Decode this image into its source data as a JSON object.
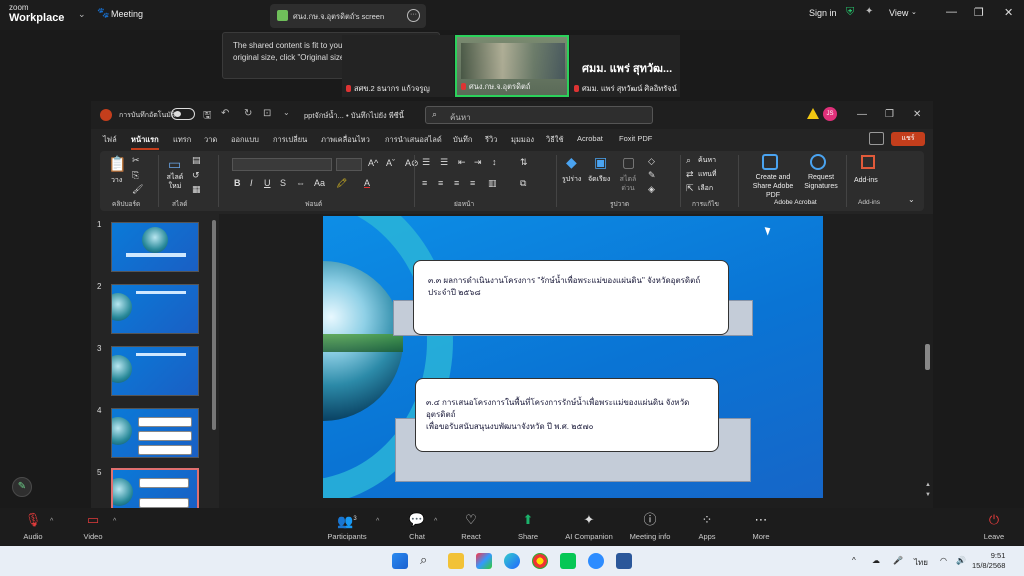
{
  "zoom": {
    "logo_line1": "zoom",
    "logo_line2": "Workplace",
    "meeting_label": "Meeting",
    "share_title": "ศนง.กษ.จ.อุตรดิตถ์'s screen",
    "sign_in": "Sign in",
    "view": "View",
    "tooltip": "The shared content is fit to your screen. To see the original size, click \"Original size\" in the menu.",
    "tiles": [
      {
        "name": "สศข.2 ธนากร แก้วจรูญ",
        "big": ""
      },
      {
        "name": "ศนง.กษ.จ.อุตรดิตถ์",
        "big": ""
      },
      {
        "name": "ศมม. แพร่ สุทวัฒน์ ศิลอิทรัจน์",
        "big": "ศมม. แพร่ สุทวัฒ..."
      }
    ],
    "bottom": {
      "audio": "Audio",
      "video": "Video",
      "participants": "Participants",
      "participants_count": "3",
      "chat": "Chat",
      "react": "React",
      "share": "Share",
      "ai_companion": "AI Companion",
      "meeting_info": "Meeting info",
      "apps": "Apps",
      "more": "More",
      "leave": "Leave"
    }
  },
  "ppt": {
    "autosave": "การบันทึกอัตโนมัติ",
    "docname": "pptจักษ์น้ำ... • บันทึกไปยัง พีซีนี้",
    "search_placeholder": "ค้นหา",
    "avatar": "JS",
    "tabs": [
      "ไฟล์",
      "หน้าแรก",
      "แทรก",
      "วาด",
      "ออกแบบ",
      "การเปลี่ยน",
      "ภาพเคลื่อนไหว",
      "การนำเสนอสไลด์",
      "บันทึก",
      "รีวิว",
      "มุมมอง",
      "วิธีใช้",
      "Acrobat",
      "Foxit PDF"
    ],
    "share_btn": "แชร์",
    "ribbon": {
      "groups": [
        "คลิปบอร์ด",
        "สไลด์",
        "ฟอนต์",
        "ย่อหน้า",
        "รูปวาด",
        "การแก้ไข",
        "Adobe Acrobat",
        "Add-ins"
      ],
      "paste": "วาง",
      "new_slide": "สไลด์ใหม่",
      "shapes": "รูปร่าง",
      "arrange": "จัดเรียง",
      "quick_styles": "สไตล์ด่วน",
      "find": "ค้นหา",
      "replace": "แทนที่",
      "select": "เลือก",
      "create_share": "Create and Share Adobe PDF",
      "request_sig": "Request Signatures",
      "addins": "Add-ins"
    },
    "thumb_numbers": [
      "1",
      "2",
      "3",
      "4",
      "5"
    ],
    "slide": {
      "box1": "๓.๓ ผลการดำเนินงานโครงการ \"รักษ์น้ำเพื่อพระแม่ของแผ่นดิน\" จังหวัดอุตรดิตถ์ ประจำปี ๒๕๖๘",
      "box2_line1": "๓.๔ การเสนอโครงการในพื้นที่โครงการรักษ์น้ำเพื่อพระแม่ของแผ่นดิน จังหวัดอุตรดิตถ์",
      "box2_line2": "เพื่อขอรับสนับสนุนงบพัฒนาจังหวัด ปี พ.ศ. ๒๕๗๐"
    }
  },
  "taskbar": {
    "tray_lang": "ไทย",
    "time": "9:51",
    "date": "15/8/2568"
  }
}
